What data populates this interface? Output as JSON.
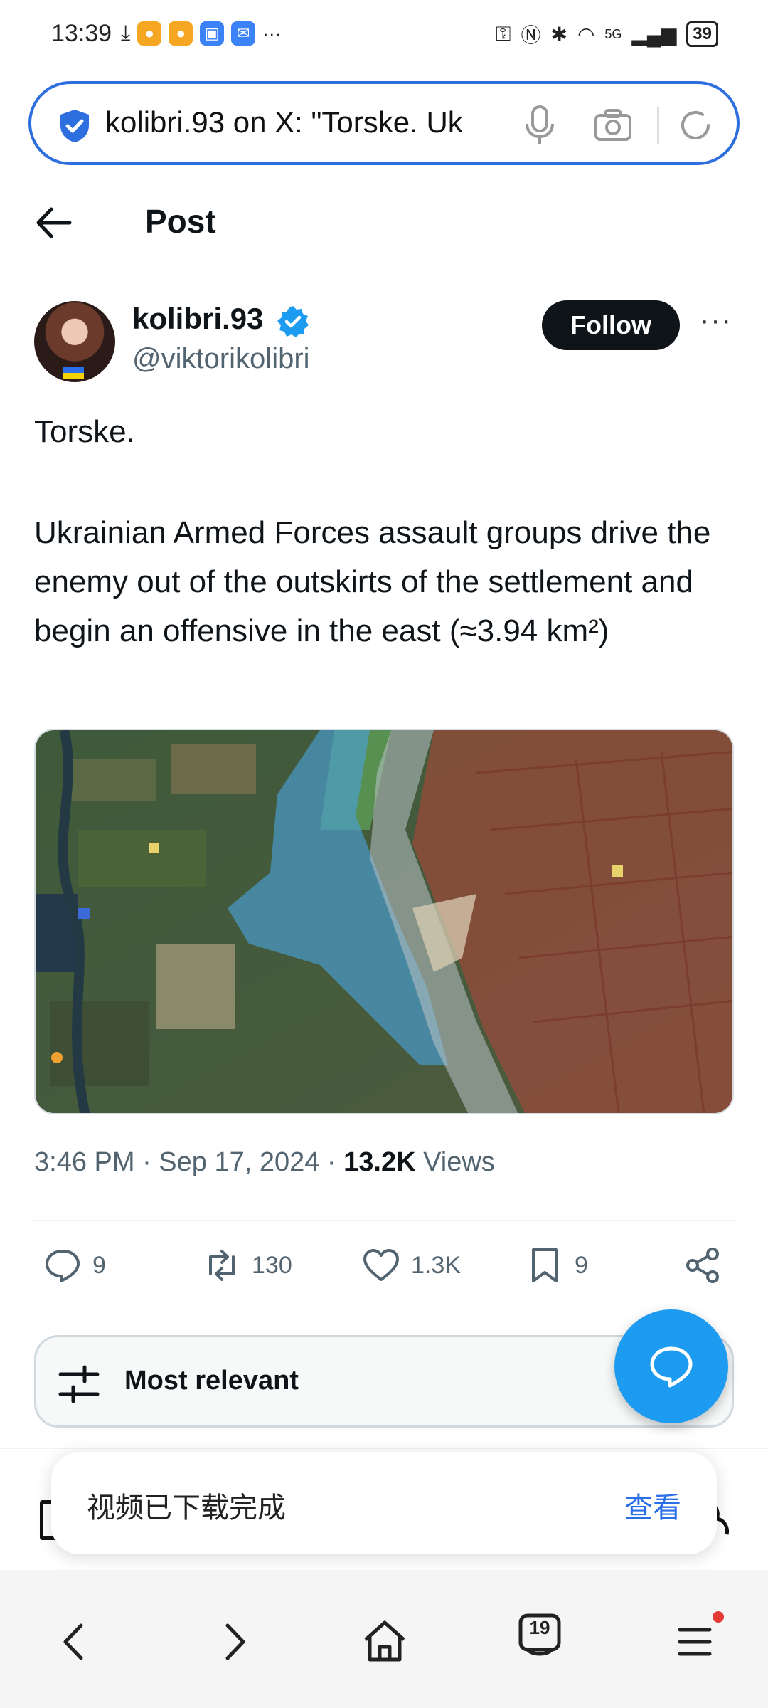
{
  "status_bar": {
    "time": "13:39",
    "battery": "39",
    "signal_label": "5G",
    "overflow": "···"
  },
  "browser": {
    "url_text": "kolibri.93 on X: \"Torske. Uk",
    "tab_count": "19"
  },
  "header": {
    "title": "Post"
  },
  "author": {
    "name": "kolibri.93",
    "handle": "@viktorikolibri",
    "follow_label": "Follow",
    "more": "···"
  },
  "tweet": {
    "line1": "Torske.",
    "paragraph": "Ukrainian Armed Forces assault groups drive the enemy out of the outskirts of the settlement and begin an offensive in the east (≈3.94 km²)"
  },
  "meta": {
    "time": "3:46 PM · Sep 17, 2024 · ",
    "views_count": "13.2K",
    "views_label": " Views"
  },
  "actions": {
    "replies": "9",
    "reposts": "130",
    "likes": "1.3K",
    "bookmarks": "9"
  },
  "sort": {
    "label": "Most relevant"
  },
  "toast": {
    "message": "视频已下载完成",
    "action": "查看"
  },
  "colors": {
    "accent": "#1d9bf0",
    "url_border": "#2e6fe0",
    "follow_bg": "#0f1419",
    "muted_text": "#536471",
    "toast_action": "#2a6ee8"
  }
}
